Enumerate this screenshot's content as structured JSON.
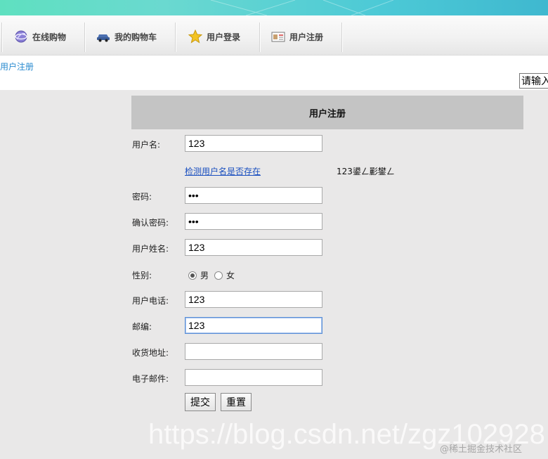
{
  "nav": {
    "items": [
      {
        "label": "在线购物",
        "icon": "globe-icon"
      },
      {
        "label": "我的购物车",
        "icon": "car-icon"
      },
      {
        "label": "用户登录",
        "icon": "star-icon"
      },
      {
        "label": "用户注册",
        "icon": "id-card-icon"
      }
    ]
  },
  "breadcrumb": "用户注册",
  "search": {
    "value": "请输入"
  },
  "form": {
    "title": "用户注册",
    "username_label": "用户名:",
    "username_value": "123",
    "check_link": "检测用户名是否存在",
    "check_result": "123鍙ㄥ彲鐢ㄥ",
    "password_label": "密码:",
    "password_value": "•••",
    "confirm_label": "确认密码:",
    "confirm_value": "•••",
    "realname_label": "用户姓名:",
    "realname_value": "123",
    "gender_label": "性别:",
    "gender_male": "男",
    "gender_female": "女",
    "phone_label": "用户电话:",
    "phone_value": "123",
    "zip_label": "邮编:",
    "zip_value": "123",
    "address_label": "收货地址:",
    "address_value": "",
    "email_label": "电子邮件:",
    "email_value": "",
    "submit_label": "提交",
    "reset_label": "重置"
  },
  "watermark": {
    "url": "https://blog.csdn.net/zgz102928",
    "site": "@稀土掘金技术社区"
  },
  "colors": {
    "link": "#1a4fbf",
    "crumb": "#2a8bd0",
    "header_bg": "#c4c4c4"
  }
}
